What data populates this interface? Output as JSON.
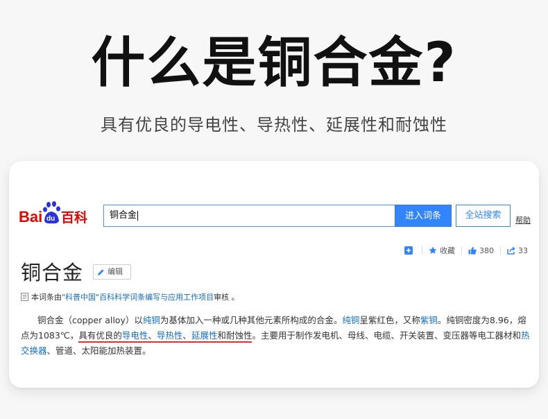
{
  "header": {
    "title": "什么是铜合金?",
    "subtitle": "具有优良的导电性、导热性、延展性和耐蚀性"
  },
  "baike": {
    "logo": {
      "text_bai": "Bai",
      "text_du": "du",
      "text_baike": "百科"
    },
    "search": {
      "value": "铜合金"
    },
    "buttons": {
      "enter": "进入词条",
      "site": "全站搜索"
    },
    "help": "帮助",
    "actions": {
      "favorite": "收藏",
      "likes": "380",
      "shares": "33"
    },
    "entry": {
      "title": "铜合金",
      "edit": "编辑",
      "notice": {
        "prefix": "本词条由",
        "org": "\"科普中国\"百科科学词条编写与应用工作项目",
        "suffix": " 审核 。"
      },
      "para": {
        "p1": "铜合金（copper alloy）以",
        "l1": "纯铜",
        "p2": "为基体加入一种或几种其他元素所构成的合金。",
        "l2": "纯铜",
        "p3": "呈紫红色，又称",
        "l3": "紫铜",
        "p4": "。纯铜密度为8.96，熔点为1083℃，",
        "u1": "具有优良的",
        "l4": "导电性",
        "u2": "、",
        "l5": "导热性",
        "u3": "、",
        "l6": "延展性",
        "u4": "和耐蚀性",
        "p5": "。主要用于制作发电机、母线、电缆、开关装置、变压器等电工器材和",
        "l7": "热交换器",
        "p6": "、管道、太阳能加热装置。"
      }
    },
    "colors": {
      "accent": "#3385ff",
      "link": "#136ec2",
      "underline": "#e03030",
      "logo_red": "#e10601"
    }
  }
}
